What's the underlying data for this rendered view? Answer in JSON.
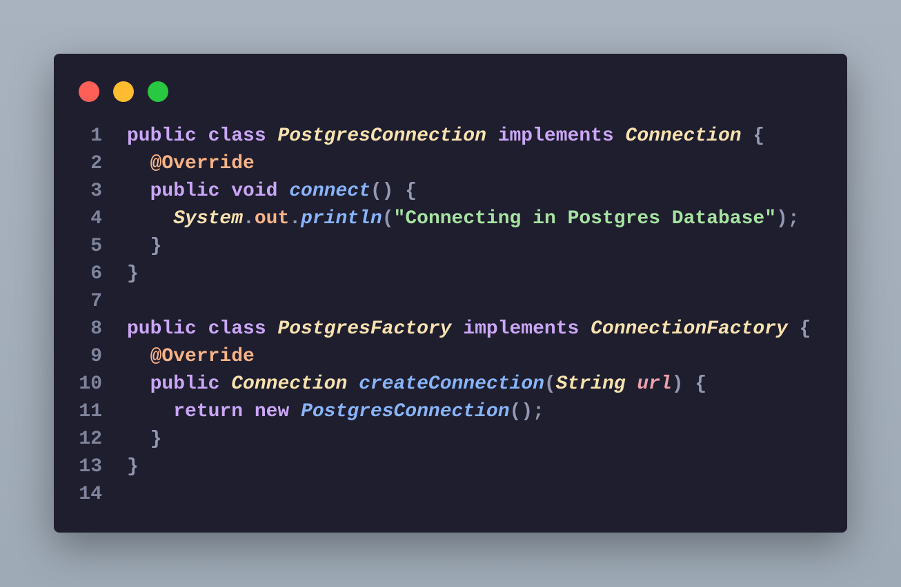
{
  "window": {
    "controls": [
      {
        "name": "close",
        "color": "#ff5f57"
      },
      {
        "name": "minimize",
        "color": "#febc2e"
      },
      {
        "name": "maximize",
        "color": "#28c840"
      }
    ]
  },
  "code": {
    "language": "java",
    "lines": [
      [
        [
          "keyword",
          "public class "
        ],
        [
          "type",
          "PostgresConnection"
        ],
        [
          "keyword",
          " implements "
        ],
        [
          "type",
          "Connection"
        ],
        [
          "punct",
          " {"
        ]
      ],
      [
        [
          "plain",
          "  "
        ],
        [
          "annotation",
          "@Override"
        ]
      ],
      [
        [
          "plain",
          "  "
        ],
        [
          "keyword",
          "public void "
        ],
        [
          "function",
          "connect"
        ],
        [
          "punct",
          "() {"
        ]
      ],
      [
        [
          "plain",
          "    "
        ],
        [
          "type",
          "System"
        ],
        [
          "punct",
          "."
        ],
        [
          "field",
          "out"
        ],
        [
          "punct",
          "."
        ],
        [
          "function",
          "println"
        ],
        [
          "punct",
          "("
        ],
        [
          "string",
          "\"Connecting in Postgres Database\""
        ],
        [
          "punct",
          ");"
        ]
      ],
      [
        [
          "plain",
          "  "
        ],
        [
          "punct",
          "}"
        ]
      ],
      [
        [
          "punct",
          "}"
        ]
      ],
      [],
      [
        [
          "keyword",
          "public class "
        ],
        [
          "type",
          "PostgresFactory"
        ],
        [
          "keyword",
          " implements "
        ],
        [
          "type",
          "ConnectionFactory"
        ],
        [
          "punct",
          " {"
        ]
      ],
      [
        [
          "plain",
          "  "
        ],
        [
          "annotation",
          "@Override"
        ]
      ],
      [
        [
          "plain",
          "  "
        ],
        [
          "keyword",
          "public "
        ],
        [
          "type",
          "Connection"
        ],
        [
          "plain",
          " "
        ],
        [
          "function",
          "createConnection"
        ],
        [
          "punct",
          "("
        ],
        [
          "type",
          "String"
        ],
        [
          "plain",
          " "
        ],
        [
          "param",
          "url"
        ],
        [
          "punct",
          ") {"
        ]
      ],
      [
        [
          "plain",
          "    "
        ],
        [
          "keyword",
          "return new "
        ],
        [
          "function",
          "PostgresConnection"
        ],
        [
          "punct",
          "();"
        ]
      ],
      [
        [
          "plain",
          "  "
        ],
        [
          "punct",
          "}"
        ]
      ],
      [
        [
          "punct",
          "}"
        ]
      ],
      []
    ]
  }
}
